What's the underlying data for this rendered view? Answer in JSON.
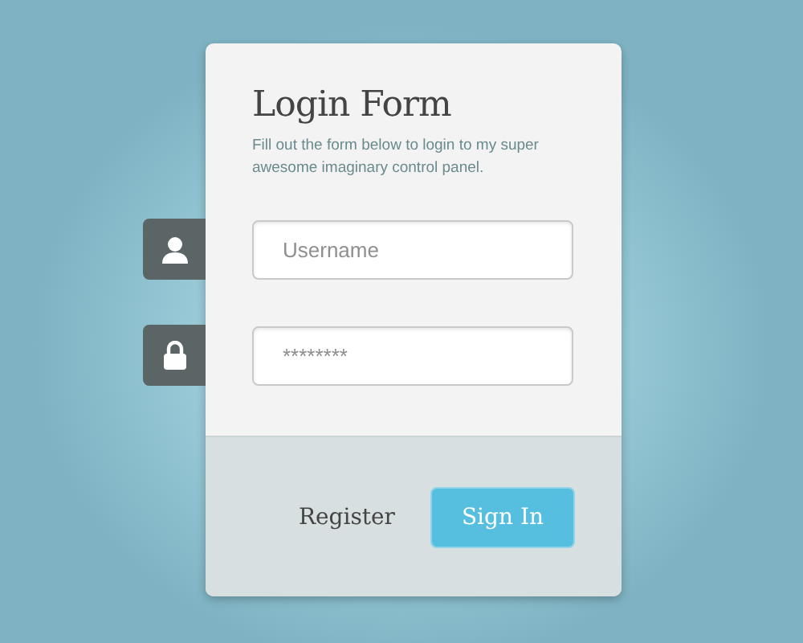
{
  "form": {
    "title": "Login Form",
    "description": "Fill out the form below to login to my super awesome imaginary control panel."
  },
  "fields": [
    {
      "kind": "user",
      "placeholder": "Username"
    },
    {
      "kind": "password",
      "placeholder": "********"
    }
  ],
  "actions": {
    "link": "Register",
    "button": "Sign In"
  }
}
